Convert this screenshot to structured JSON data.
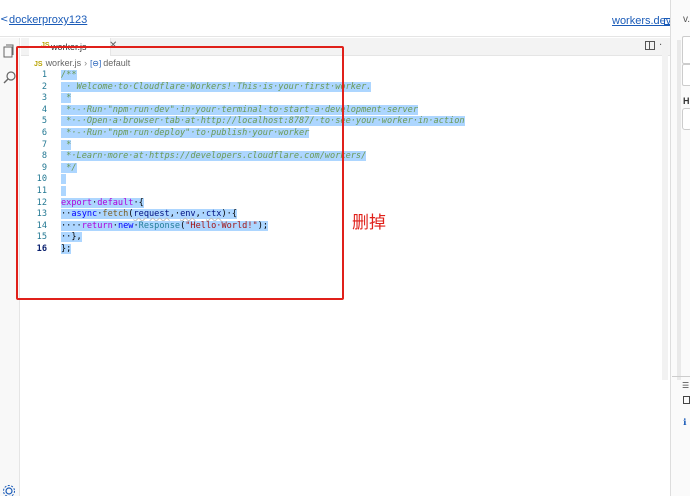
{
  "header": {
    "project_name": "dockerproxy123",
    "domain_link": "workers.dev"
  },
  "right_panel": {
    "version_label": "v.",
    "heading_label": "H"
  },
  "tab": {
    "js_badge": "JS",
    "label": "worker.js",
    "close": "✕"
  },
  "breadcrumb": {
    "file": "worker.js",
    "symbol": "default"
  },
  "editor": {
    "active_line": 16,
    "line_numbers": [
      "1",
      "2",
      "3",
      "4",
      "5",
      "6",
      "7",
      "8",
      "9",
      "10",
      "11",
      "12",
      "13",
      "14",
      "15",
      "16"
    ]
  },
  "annotation": {
    "text": "删掉"
  }
}
